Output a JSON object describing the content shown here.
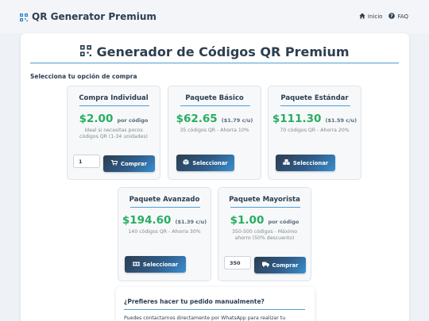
{
  "header": {
    "brand": "QR Generator Premium",
    "nav": [
      {
        "label": "Inicio",
        "icon": "home-icon"
      },
      {
        "label": "FAQ",
        "icon": "question-circle-icon"
      }
    ]
  },
  "main": {
    "title": "Generador de Códigos QR Premium",
    "section_label": "Selecciona tu opción de compra"
  },
  "packages": [
    {
      "name": "Compra Individual",
      "price": "$2.00",
      "unit": "por código",
      "desc": "Ideal si necesitas pocos códigos QR (1-34 unidades)",
      "quantity": "1",
      "button": "Comprar",
      "button_icon": "cart-icon"
    },
    {
      "name": "Paquete Básico",
      "price": "$62.65",
      "unit": "($1.79 c/u)",
      "desc": "35 códigos QR - Ahorra 10%",
      "button": "Seleccionar",
      "button_icon": "box-icon"
    },
    {
      "name": "Paquete Estándar",
      "price": "$111.30",
      "unit": "($1.59 c/u)",
      "desc": "70 códigos QR - Ahorra 20%",
      "button": "Seleccionar",
      "button_icon": "boxes-icon"
    },
    {
      "name": "Paquete Avanzado",
      "price": "$194.60",
      "unit": "($1.39 c/u)",
      "desc": "140 códigos QR - Ahorra 30%",
      "button": "Seleccionar",
      "button_icon": "pallet-icon"
    },
    {
      "name": "Paquete Mayorista",
      "price": "$1.00",
      "unit": "por código",
      "desc": "350-500 códigos - Máximo ahorro (50% descuento)",
      "quantity": "350",
      "button": "Comprar",
      "button_icon": "truck-icon"
    }
  ],
  "manual": {
    "title": "¿Prefieres hacer tu pedido manualmente?",
    "text": "Puedes contactarnos directamente por WhatsApp para realizar tu"
  },
  "colors": {
    "accent": "#4a9fd6",
    "price": "#27ae60",
    "text": "#2c3e50",
    "button_start": "#2c3e50",
    "button_end": "#3a8fd0"
  }
}
